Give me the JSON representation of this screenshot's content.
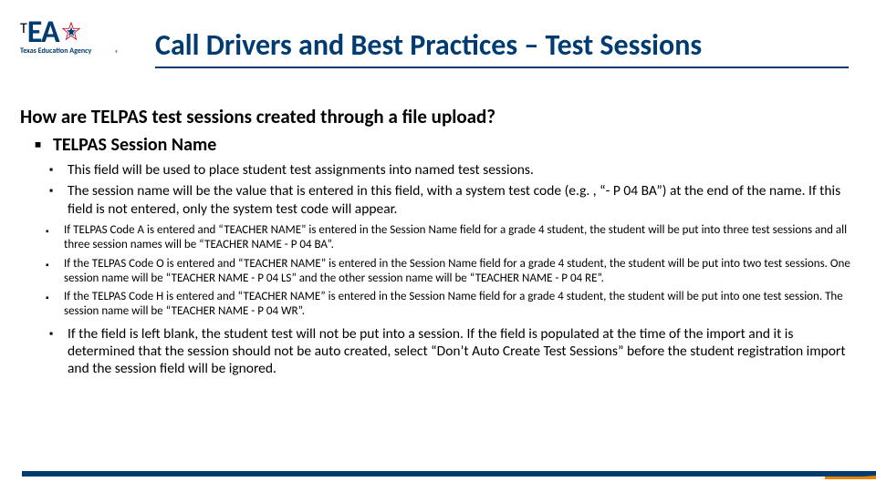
{
  "logo": {
    "t": "T",
    "ea": "EA",
    "sub": "Texas Education Agency",
    "reg": "®"
  },
  "title": "Call Drivers and Best Practices – Test Sessions",
  "question": "How are TELPAS test sessions created through a file upload?",
  "lvl1_1": "TELPAS Session Name",
  "lvl2_1": "This field will be used to place student test assignments into named test sessions.",
  "lvl2_2": "The session name will be the value that is entered in this field, with a system test code (e.g. , “- P 04 BA”) at the end of the name. If this field is not entered, only the system test code will appear.",
  "lvl3_1": "If TELPAS Code A is entered and “TEACHER NAME” is entered in the Session Name field for a grade 4 student, the student will be put into three test sessions and all three session names will be “TEACHER NAME - P 04 BA”.",
  "lvl3_2": "If the TELPAS Code O is entered and “TEACHER NAME” is entered in the Session Name field for a grade 4 student, the student will be put into two test sessions.  One session name will be “TEACHER NAME - P 04 LS” and the other session name will be “TEACHER NAME - P 04 RE”.",
  "lvl3_3": "If the TELPAS Code H is entered and “TEACHER NAME” is entered in the Session Name field for a grade 4 student, the student will be put into one test session.  The session name will be “TEACHER NAME - P 04 WR”.",
  "lvl2_3": "If the field is left blank, the student test will not be put into a session. If the field is populated at the time of the import and it is determined that the session should not be auto created, select “Don’t Auto Create Test Sessions” before the student registration import and the session field will be ignored."
}
